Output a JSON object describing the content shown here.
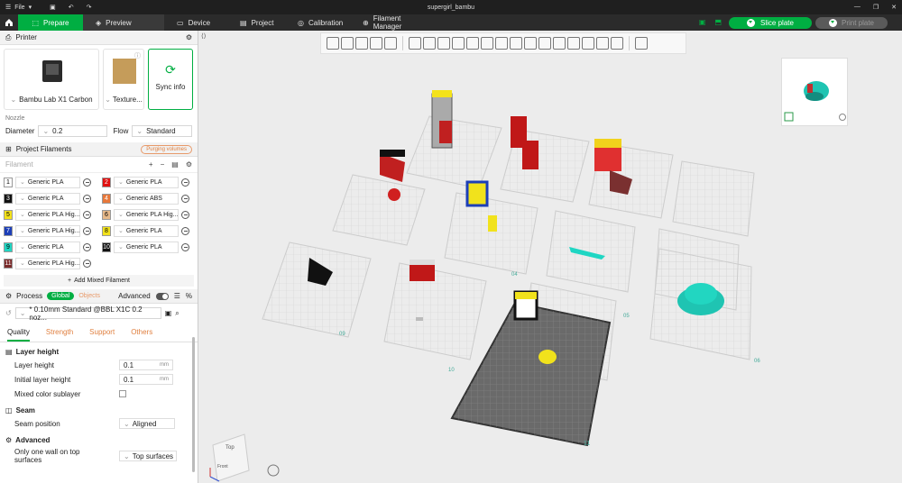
{
  "titlebar": {
    "file_label": "File",
    "title": "supergirl_bambu"
  },
  "nav": {
    "prepare": "Prepare",
    "preview": "Preview",
    "device": "Device",
    "project": "Project",
    "calibration": "Calibration",
    "filament_manager": "Filament Manager",
    "slice_plate": "Slice plate",
    "print_plate": "Print plate"
  },
  "printer": {
    "section_title": "Printer",
    "printer_name": "Bambu Lab X1 Carbon",
    "texture_label": "Texture...",
    "sync_label": "Sync info",
    "nozzle_label": "Nozzle",
    "diameter_label": "Diameter",
    "diameter_value": "0.2",
    "flow_label": "Flow",
    "flow_value": "Standard"
  },
  "filaments": {
    "section_title": "Project Filaments",
    "purging_label": "Purging volumes",
    "filament_label": "Filament",
    "items": [
      {
        "num": "1",
        "color": "#ffffff",
        "text": "#000000",
        "name": "Generic PLA"
      },
      {
        "num": "2",
        "color": "#e01010",
        "text": "#ffffff",
        "name": "Generic PLA"
      },
      {
        "num": "3",
        "color": "#111111",
        "text": "#ffffff",
        "name": "Generic PLA"
      },
      {
        "num": "4",
        "color": "#e8783a",
        "text": "#ffffff",
        "name": "Generic ABS"
      },
      {
        "num": "5",
        "color": "#f4e21a",
        "text": "#000000",
        "name": "Generic PLA Hig..."
      },
      {
        "num": "6",
        "color": "#e6b98a",
        "text": "#000000",
        "name": "Generic PLA Hig..."
      },
      {
        "num": "7",
        "color": "#1d3fb8",
        "text": "#ffffff",
        "name": "Generic PLA Hig..."
      },
      {
        "num": "8",
        "color": "#f1e21c",
        "text": "#000000",
        "name": "Generic PLA"
      },
      {
        "num": "9",
        "color": "#1fd6c3",
        "text": "#000000",
        "name": "Generic PLA"
      },
      {
        "num": "10",
        "color": "#111111",
        "text": "#ffffff",
        "name": "Generic PLA"
      },
      {
        "num": "11",
        "color": "#7a2a2a",
        "text": "#ffffff",
        "name": "Generic PLA Hig..."
      }
    ],
    "add_mixed": "Add Mixed Filament"
  },
  "process": {
    "section_title": "Process",
    "global_label": "Global",
    "objects_label": "Objects",
    "advanced_label": "Advanced",
    "preset": "* 0.10mm Standard @BBL X1C 0.2 noz...",
    "tabs": [
      "Quality",
      "Strength",
      "Support",
      "Others"
    ],
    "group_layer_height": "Layer height",
    "layer_height_label": "Layer height",
    "layer_height_value": "0.1",
    "initial_layer_height_label": "Initial layer height",
    "initial_layer_height_value": "0.1",
    "unit_mm": "mm",
    "mixed_color_label": "Mixed color sublayer",
    "group_seam": "Seam",
    "seam_position_label": "Seam position",
    "seam_position_value": "Aligned",
    "group_advanced": "Advanced",
    "one_wall_label_1": "Only one wall on top",
    "one_wall_label_2": "surfaces",
    "one_wall_value": "Top surfaces"
  },
  "viewport": {
    "plate_labels": [
      "09",
      "10",
      "11",
      "04",
      "05",
      "06"
    ],
    "cube_top": "Top",
    "cube_front": "Front"
  }
}
